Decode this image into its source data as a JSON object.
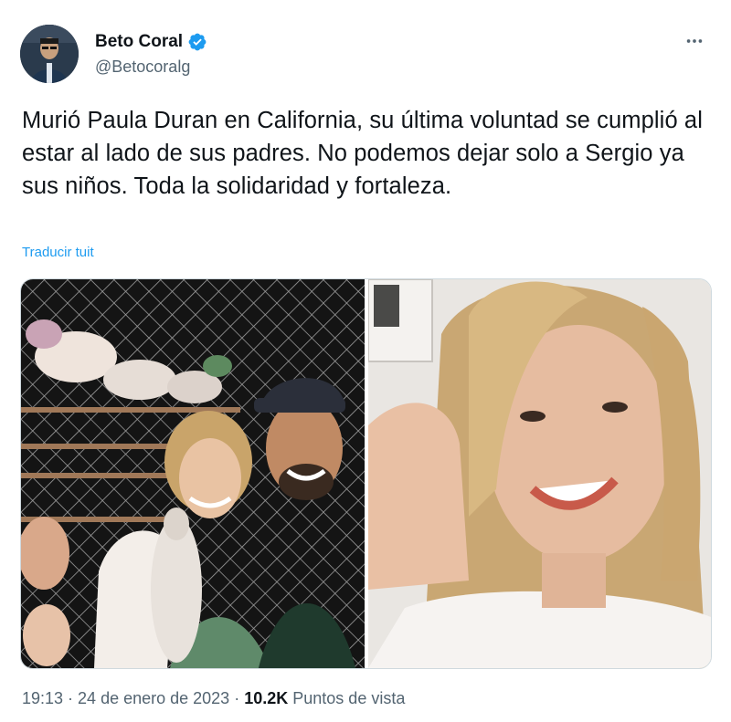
{
  "author": {
    "name": "Beto Coral",
    "handle": "@Betocoralg",
    "verified_color": "#1d9bf0"
  },
  "tweet": {
    "text": "Murió Paula Duran en California, su última voluntad se cumplió al estar al lado de sus padres. No podemos dejar solo a Sergio ya sus niños. Toda la solidaridad y fortaleza.",
    "translate_label": "Traducir tuit"
  },
  "icons": {
    "more": "more-horizontal-icon",
    "verified": "verified-badge-icon"
  },
  "meta": {
    "time": "19:13",
    "separator": " · ",
    "date": "24 de enero de 2023",
    "views_count": "10.2K",
    "views_label": "Puntos de vista"
  }
}
